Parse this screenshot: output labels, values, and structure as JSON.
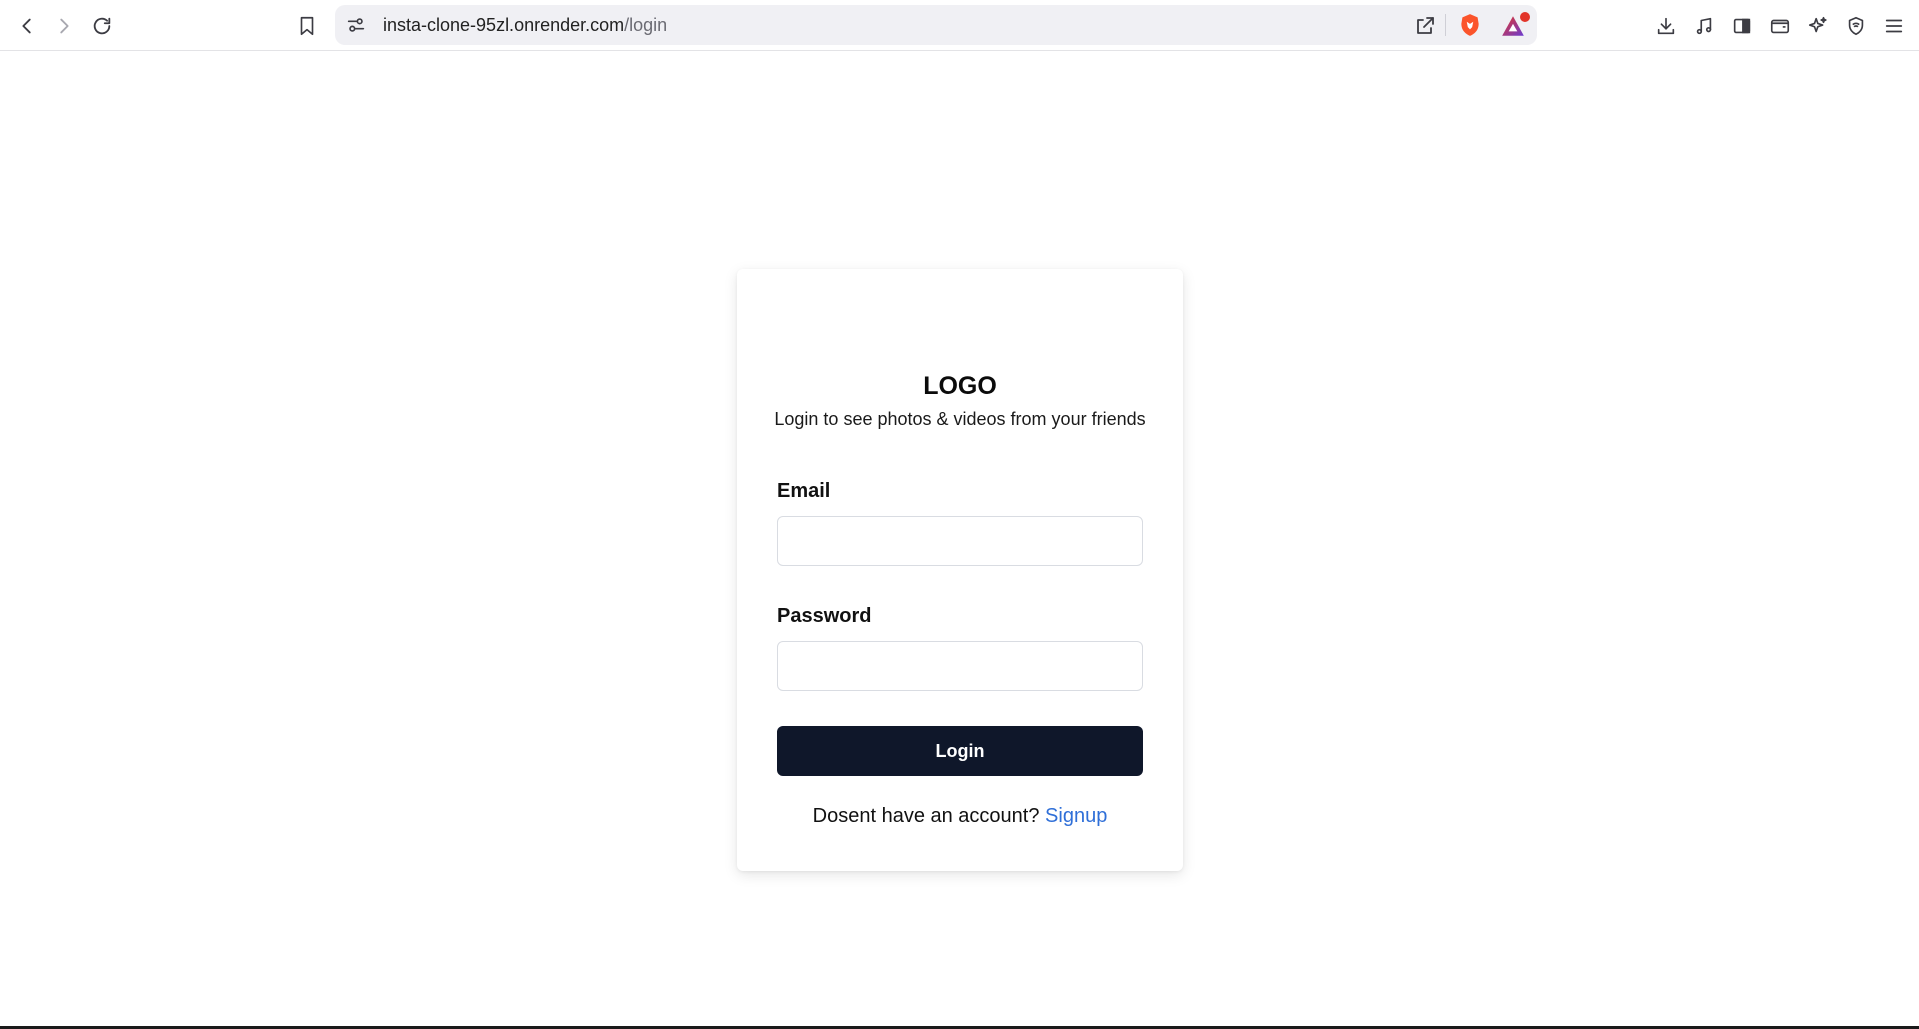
{
  "browser": {
    "url": {
      "host": "insta-clone-95zl.onrender.com",
      "path": "/login"
    },
    "rewards_badge_color": "#e2352a",
    "brave_color": "#fb542b"
  },
  "login_card": {
    "logo": "LOGO",
    "subtitle": "Login to see photos & videos from your friends",
    "email_label": "Email",
    "email_value": "",
    "password_label": "Password",
    "password_value": "",
    "login_button": "Login",
    "signup_prompt": "Dosent have an account?",
    "signup_link": "Signup"
  },
  "colors": {
    "button_bg": "#0f172a",
    "link": "#2f6fd8"
  }
}
